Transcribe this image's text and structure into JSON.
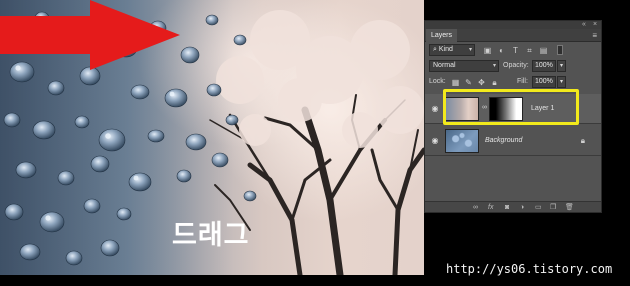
{
  "colors": {
    "arrow_red": "#e51b1b",
    "highlight_yellow": "#f2ea1c",
    "panel_bg": "#535353"
  },
  "drag_label": "드래그",
  "layers_panel": {
    "collapse_icon": "double-arrow-icon",
    "close_icon": "x-icon",
    "tab_label": "Layers",
    "menu_icon": "panel-menu-icon",
    "filter": {
      "kind_label": "Kind",
      "icons": [
        "image-filter-icon",
        "adjustment-filter-icon",
        "type-filter-icon",
        "shape-filter-icon",
        "smart-object-filter-icon"
      ]
    },
    "blend_mode": "Normal",
    "opacity_label": "Opacity:",
    "opacity_value": "100%",
    "lock_label": "Lock:",
    "lock_icons": [
      "lock-transparent-icon",
      "lock-image-icon",
      "lock-position-icon",
      "lock-all-icon"
    ],
    "fill_label": "Fill:",
    "fill_value": "100%",
    "layers": [
      {
        "name": "Layer 1",
        "visible": true,
        "has_mask": true,
        "selected": true
      },
      {
        "name": "Background",
        "visible": true,
        "locked": true
      }
    ],
    "bottom_icons": [
      "link-icon",
      "fx-icon",
      "mask-icon",
      "adjustment-icon",
      "group-icon",
      "new-layer-icon",
      "trash-icon"
    ]
  },
  "watermark_url": "http://ys06.tistory.com"
}
